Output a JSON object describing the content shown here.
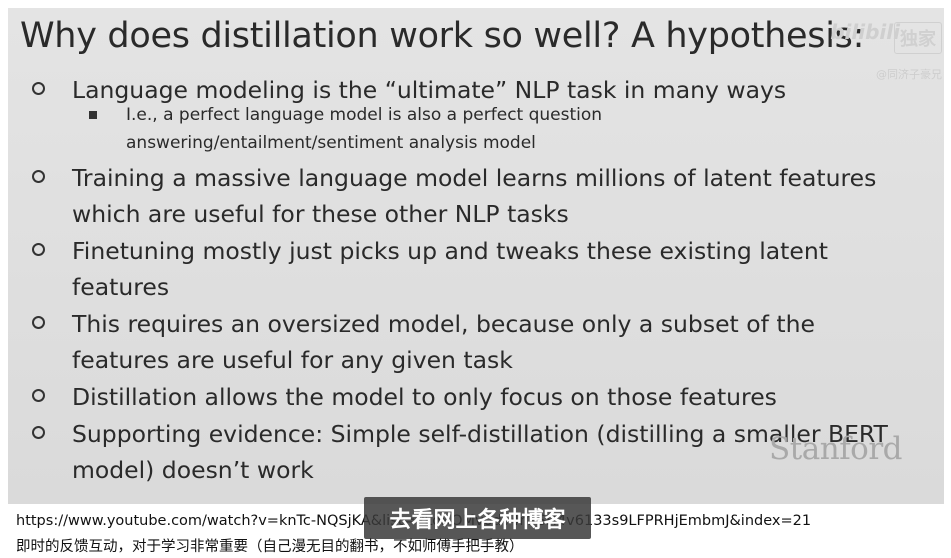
{
  "slide": {
    "title": "Why does distillation work so well? A hypothesis:",
    "bullets": [
      {
        "text": "Language modeling is the “ultimate” NLP task in many ways",
        "sub": [
          "I.e., a perfect language model is also a perfect question answering/entailment/sentiment analysis model"
        ]
      },
      {
        "text": "Training a massive language model learns millions of latent features which are useful for these other NLP tasks"
      },
      {
        "text": "Finetuning mostly just picks up and tweaks these existing latent features"
      },
      {
        "text": "This requires an oversized model, because only a subset of the features are useful for any given task"
      },
      {
        "text": "Distillation allows the model to only focus on those features"
      },
      {
        "text": "Supporting evidence: Simple self-distillation (distilling a smaller BERT model) doesn’t work"
      }
    ],
    "logo": "Stanford"
  },
  "watermark": {
    "site": "bilibili",
    "badge": "独家",
    "uploader": "@同济子豪兄"
  },
  "subtitle": "去看网上各种博客",
  "footer": {
    "url": "https://www.youtube.com/watch?v=knTc-NQSjKA&list=PLoROMvodv4rOSH4v6133s9LFPRHjEmbmJ&index=21",
    "note": "即时的反馈互动，对于学习非常重要（自己漫无目的翻书，不如师傅手把手教）"
  }
}
